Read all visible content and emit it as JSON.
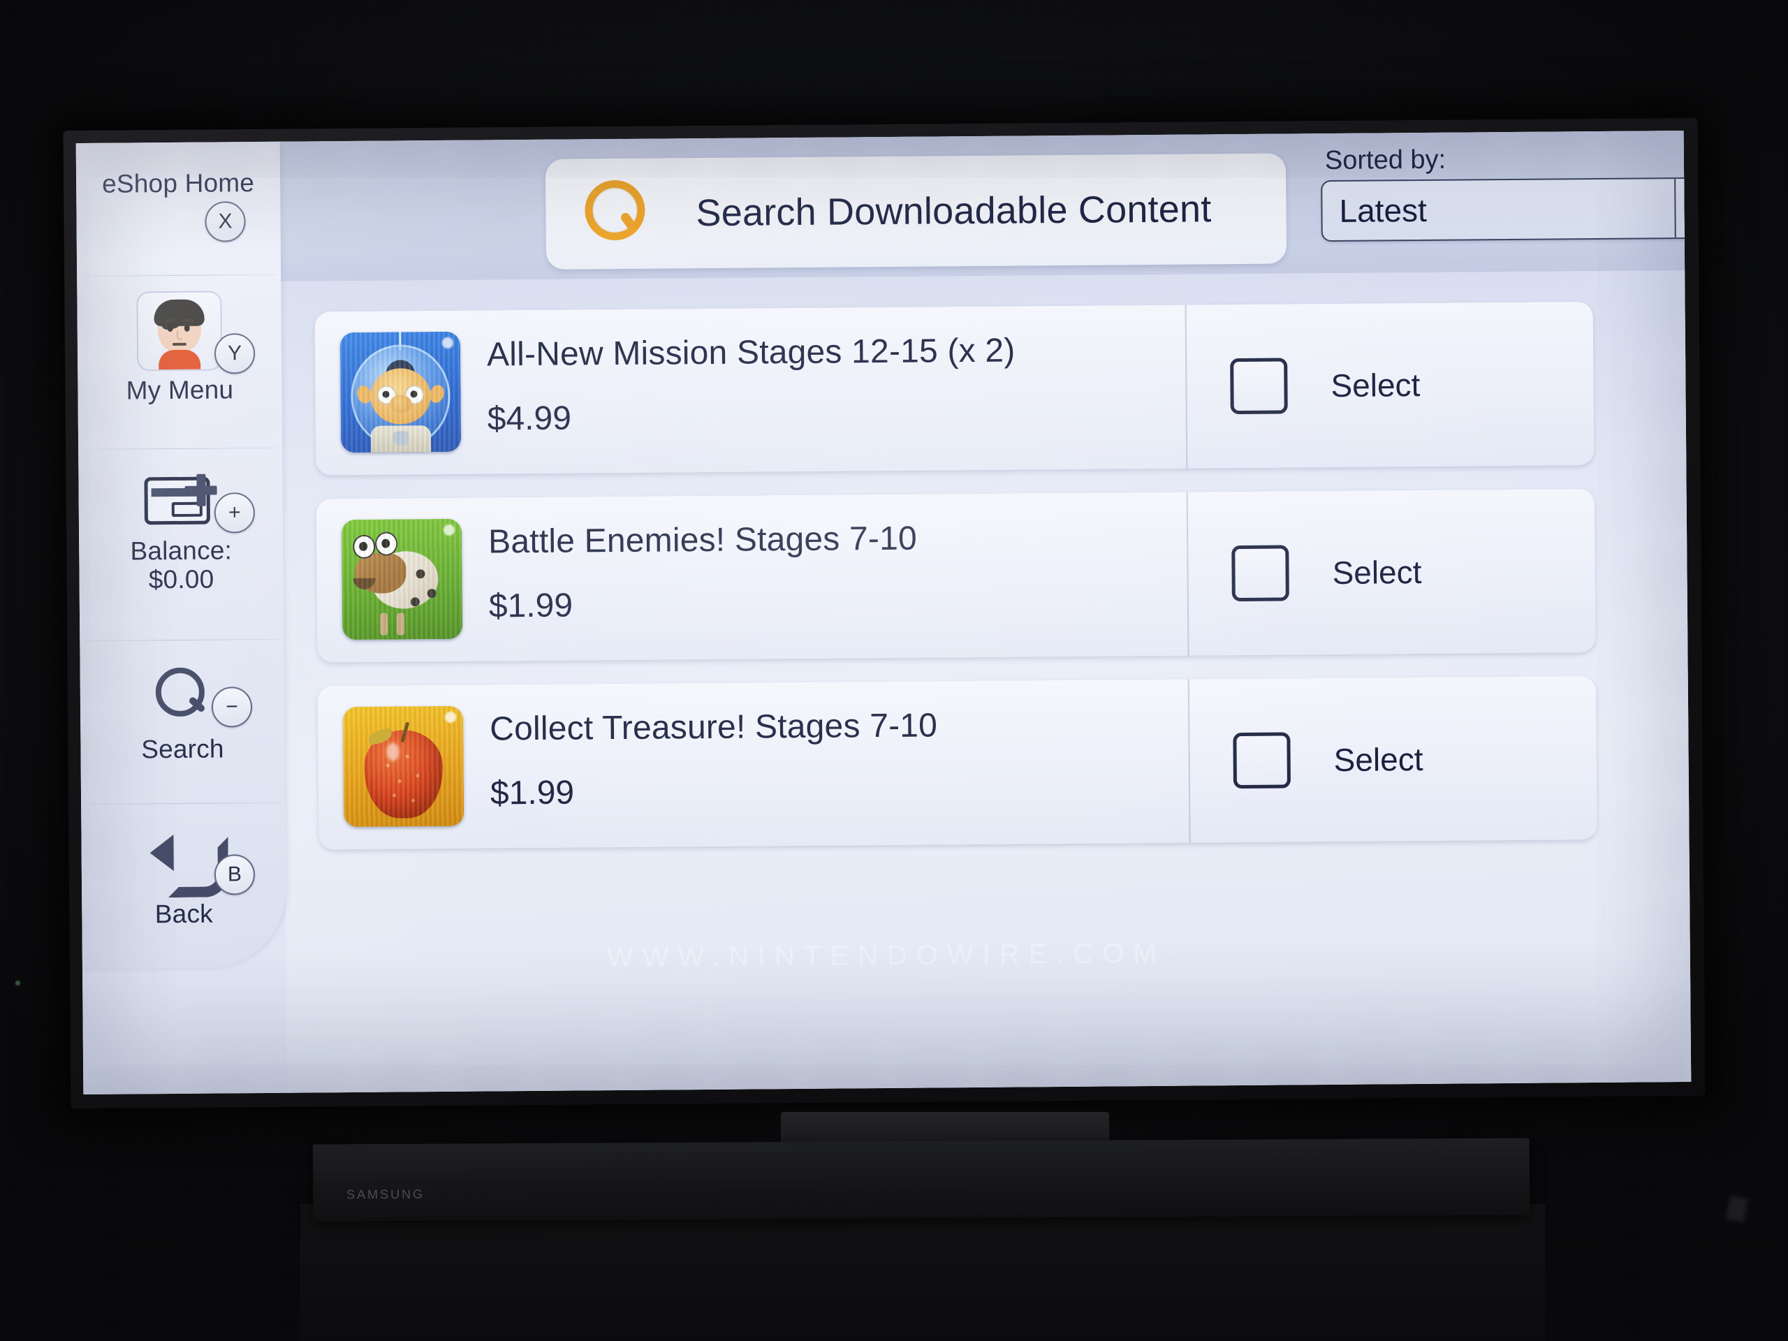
{
  "screen": {
    "watermark": "WWW.NINTENDOWIRE.COM"
  },
  "sidebar": {
    "items": [
      {
        "label": "eShop Home",
        "button": "X",
        "icon": "none"
      },
      {
        "label": "My Menu",
        "button": "Y",
        "icon": "mii-avatar"
      },
      {
        "label": "Balance:\n$0.00",
        "button": "+",
        "icon": "add-funds-card"
      },
      {
        "label": "Search",
        "button": "−",
        "icon": "magnifier"
      },
      {
        "label": "Back",
        "button": "B",
        "icon": "back-arrow"
      }
    ]
  },
  "topbar": {
    "search_icon": "magnifier-icon",
    "search_title": "Search Downloadable Content",
    "sort": {
      "label": "Sorted by:",
      "value": "Latest",
      "arrow_icon": "chevron-down-icon"
    }
  },
  "results": {
    "select_label": "Select",
    "rows": [
      {
        "title": "All-New Mission Stages 12-15 (x 2)",
        "price": "$4.99",
        "thumb": "olimar-blue-helmet",
        "checked": false
      },
      {
        "title": "Battle Enemies! Stages 7-10",
        "price": "$1.99",
        "thumb": "bulborb-green",
        "checked": false
      },
      {
        "title": "Collect Treasure! Stages 7-10",
        "price": "$1.99",
        "thumb": "strawberry-orange",
        "checked": false
      }
    ]
  },
  "device": {
    "soundbar_brand": "SAMSUNG"
  },
  "colors": {
    "accent_orange": "#eda01e",
    "text_dark": "#161d3b",
    "panel_light": "#f4f6fc",
    "screen_bg": "#e3e8f6"
  }
}
